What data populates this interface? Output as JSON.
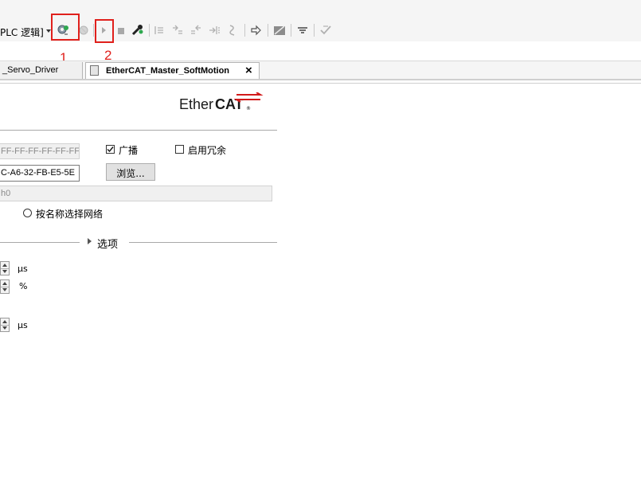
{
  "toolbar": {
    "mode_dropdown_text": "PLC 逻辑]",
    "annotations": [
      "1",
      "2"
    ]
  },
  "tabs": [
    {
      "label": "_Servo_Driver",
      "active": false
    },
    {
      "label": "EtherCAT_Master_SoftMotion",
      "active": true,
      "close": "×"
    }
  ],
  "logo": {
    "text_plain": "Ether",
    "text_bold": "CAT",
    "reg": "®"
  },
  "master": {
    "dest_address_value": "FF-FF-FF-FF-FF-FF",
    "broadcast_label": "广播",
    "broadcast_checked": true,
    "redundancy_label": "启用冗余",
    "redundancy_checked": false,
    "source_address_value": "C-A6-32-FB-E5-5E",
    "browse_label": "浏览...",
    "network_name_value": "h0",
    "select_by_name_label": "按名称选择网络"
  },
  "options": {
    "section_label": "选项",
    "units": [
      "μs",
      "%",
      "μs"
    ]
  },
  "colors": {
    "annotation": "#e0201c",
    "logo_red": "#d21a1a"
  }
}
